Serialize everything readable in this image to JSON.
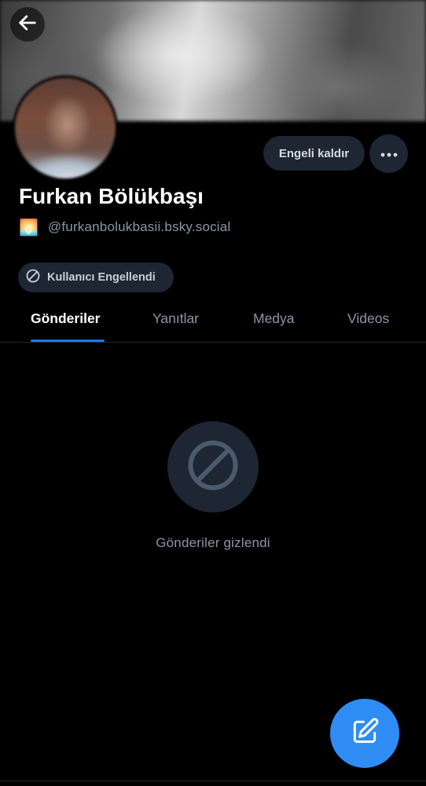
{
  "profile": {
    "display_name": "Furkan Bölükbaşı",
    "handle_emoji": "🌅",
    "handle": "@furkanbolukbasii.bsky.social"
  },
  "actions": {
    "unblock_label": "Engeli kaldır",
    "more_icon": "more-horizontal-icon",
    "back_icon": "arrow-left-icon"
  },
  "status": {
    "blocked_label": "Kullanıcı Engellendi",
    "blocked_icon": "block-icon"
  },
  "tabs": [
    {
      "label": "Gönderiler",
      "active": true
    },
    {
      "label": "Yanıtlar",
      "active": false
    },
    {
      "label": "Medya",
      "active": false
    },
    {
      "label": "Videos",
      "active": false
    }
  ],
  "empty_state": {
    "icon": "block-icon",
    "message": "Gönderiler gizlendi"
  },
  "fab": {
    "icon": "compose-icon"
  },
  "colors": {
    "accent": "#1f7ae0",
    "fab": "#2f8cf5",
    "pill_bg": "#1e2633",
    "muted_text": "#8a96a8"
  }
}
